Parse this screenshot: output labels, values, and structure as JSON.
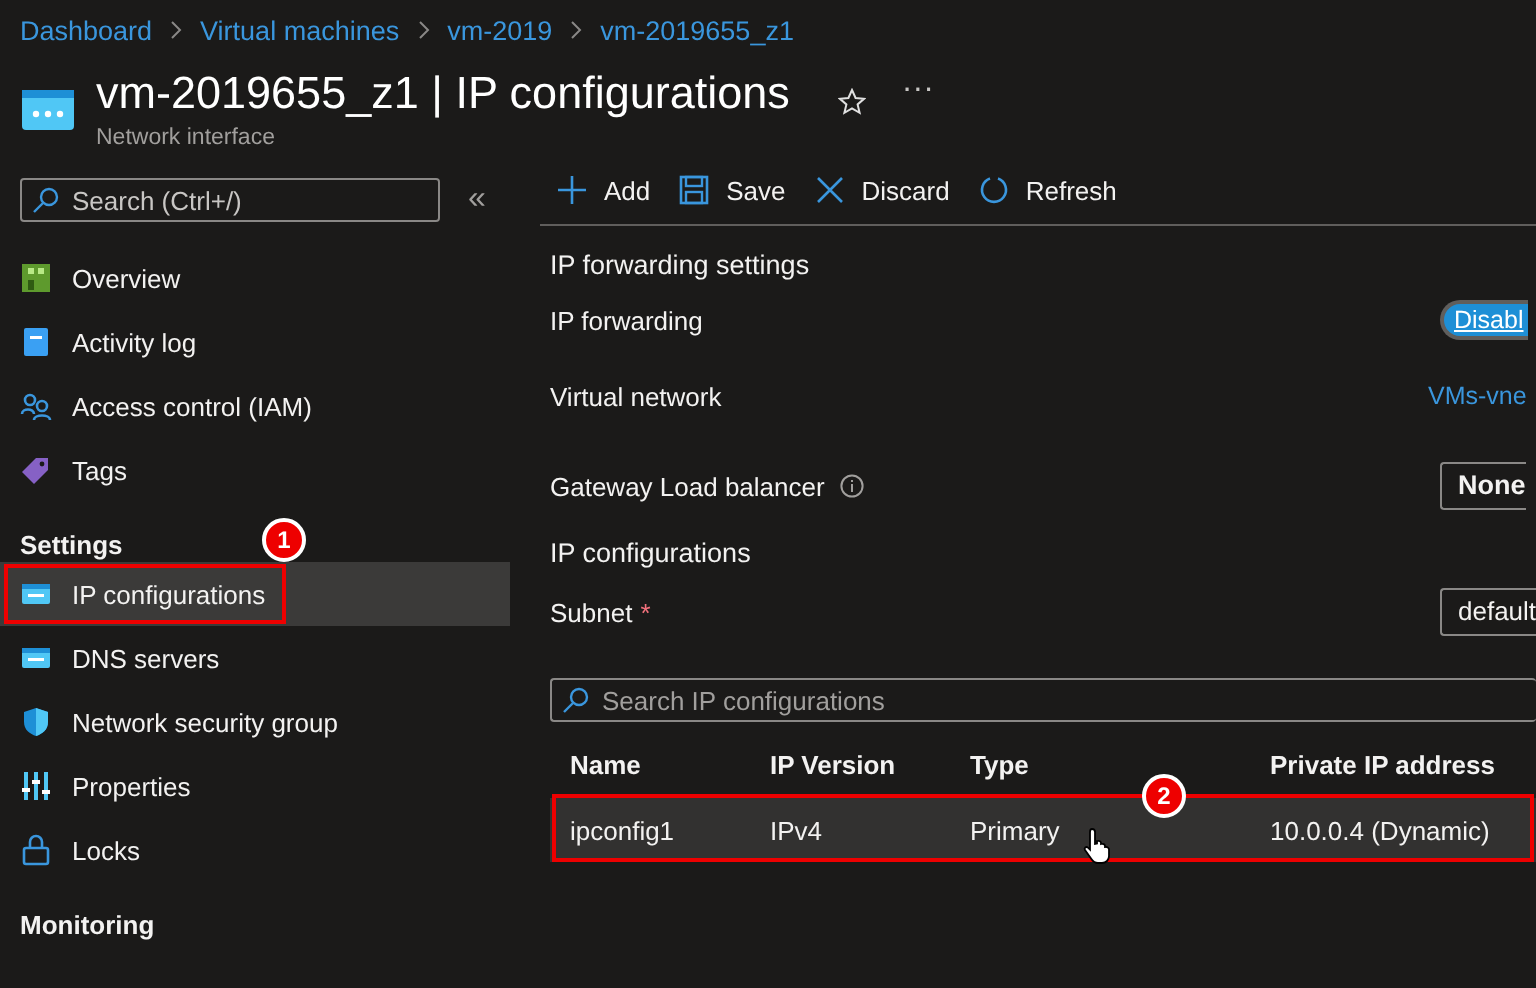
{
  "breadcrumb": [
    "Dashboard",
    "Virtual machines",
    "vm-2019",
    "vm-2019655_z1"
  ],
  "header": {
    "title": "vm-2019655_z1 | IP configurations",
    "subtitle": "Network interface",
    "more": "···"
  },
  "sidebar": {
    "search_placeholder": "Search (Ctrl+/)",
    "collapse": "«",
    "groups": [
      {
        "items": [
          {
            "label": "Overview",
            "selected": false
          },
          {
            "label": "Activity log",
            "selected": false
          },
          {
            "label": "Access control (IAM)",
            "selected": false
          },
          {
            "label": "Tags",
            "selected": false
          }
        ]
      },
      {
        "heading": "Settings",
        "items": [
          {
            "label": "IP configurations",
            "selected": true,
            "callout": "1"
          },
          {
            "label": "DNS servers",
            "selected": false
          },
          {
            "label": "Network security group",
            "selected": false
          },
          {
            "label": "Properties",
            "selected": false
          },
          {
            "label": "Locks",
            "selected": false
          }
        ]
      },
      {
        "heading": "Monitoring"
      }
    ]
  },
  "toolbar": [
    "Add",
    "Save",
    "Discard",
    "Refresh"
  ],
  "forwarding": {
    "heading": "IP forwarding settings",
    "rows": [
      {
        "kind": "toggle",
        "label": "IP forwarding",
        "value": "Disabl"
      },
      {
        "kind": "link",
        "label": "Virtual network",
        "value": "VMs-vne"
      },
      {
        "kind": "select",
        "label": "Gateway Load balancer",
        "info": true,
        "value": "None"
      }
    ]
  },
  "ip_configurations": {
    "heading": "IP configurations",
    "subnet": {
      "label": "Subnet",
      "required_mark": "*",
      "value": "default"
    },
    "search_placeholder": "Search IP configurations",
    "table": {
      "columns": [
        "Name",
        "IP Version",
        "Type",
        "Private IP address"
      ],
      "rows": [
        {
          "cells": [
            "ipconfig1",
            "IPv4",
            "Primary",
            "10.0.0.4 (Dynamic)"
          ],
          "selected": true,
          "callout": "2"
        }
      ]
    }
  }
}
